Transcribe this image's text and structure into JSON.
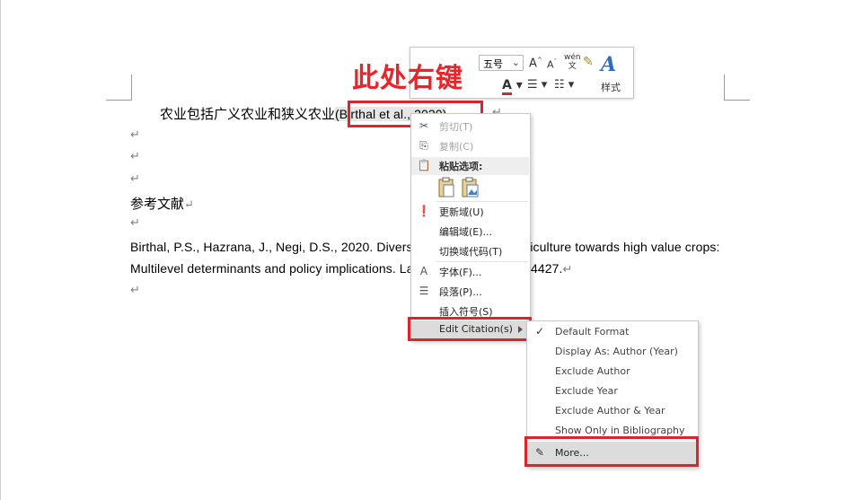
{
  "annotation": {
    "text": "此处右键"
  },
  "document": {
    "line1_prefix": "农业包括广义农业和狭义农业",
    "citation": "(Birthal et al., 2020)",
    "heading": "参考文献",
    "ref_line1": "Birthal, P.S., Hazrana, J., Negi, D.S., 2020. Diversification in Indian agriculture towards high value crops:",
    "ref_line2": "Multilevel determinants and policy implications. Land Use Policy 91, 104427.",
    "para_mark": "↵"
  },
  "mini_toolbar": {
    "font_size": "五号",
    "grow_font": "A",
    "shrink_font": "A",
    "phonetic": "wén",
    "styles_label": "样式"
  },
  "context_menu": {
    "items": [
      {
        "label": "剪切(T)",
        "icon": "cut-icon",
        "disabled": true
      },
      {
        "label": "复制(C)",
        "icon": "copy-icon",
        "disabled": true
      },
      {
        "label": "粘贴选项:",
        "icon": "paste-icon",
        "disabled": false
      },
      {
        "label": "更新域(U)",
        "icon": "update-field-icon",
        "disabled": false
      },
      {
        "label": "编辑域(E)...",
        "icon": "",
        "disabled": false
      },
      {
        "label": "切换域代码(T)",
        "icon": "",
        "disabled": false
      },
      {
        "label": "字体(F)...",
        "icon": "font-icon",
        "disabled": false
      },
      {
        "label": "段落(P)...",
        "icon": "paragraph-icon",
        "disabled": false
      },
      {
        "label": "插入符号(S)",
        "icon": "",
        "disabled": false
      },
      {
        "label": "Edit Citation(s)",
        "icon": "",
        "disabled": false
      }
    ]
  },
  "submenu": {
    "items": [
      {
        "label": "Default Format",
        "checked": true
      },
      {
        "label": "Display As: Author (Year)",
        "checked": false
      },
      {
        "label": "Exclude Author",
        "checked": false
      },
      {
        "label": "Exclude Year",
        "checked": false
      },
      {
        "label": "Exclude Author & Year",
        "checked": false
      },
      {
        "label": "Show Only in Bibliography",
        "checked": false
      },
      {
        "label": "More...",
        "checked": false
      }
    ]
  },
  "colors": {
    "highlight_red": "#d9262c",
    "annotation_red": "#e8252a",
    "styles_blue": "#2b6cc4"
  }
}
